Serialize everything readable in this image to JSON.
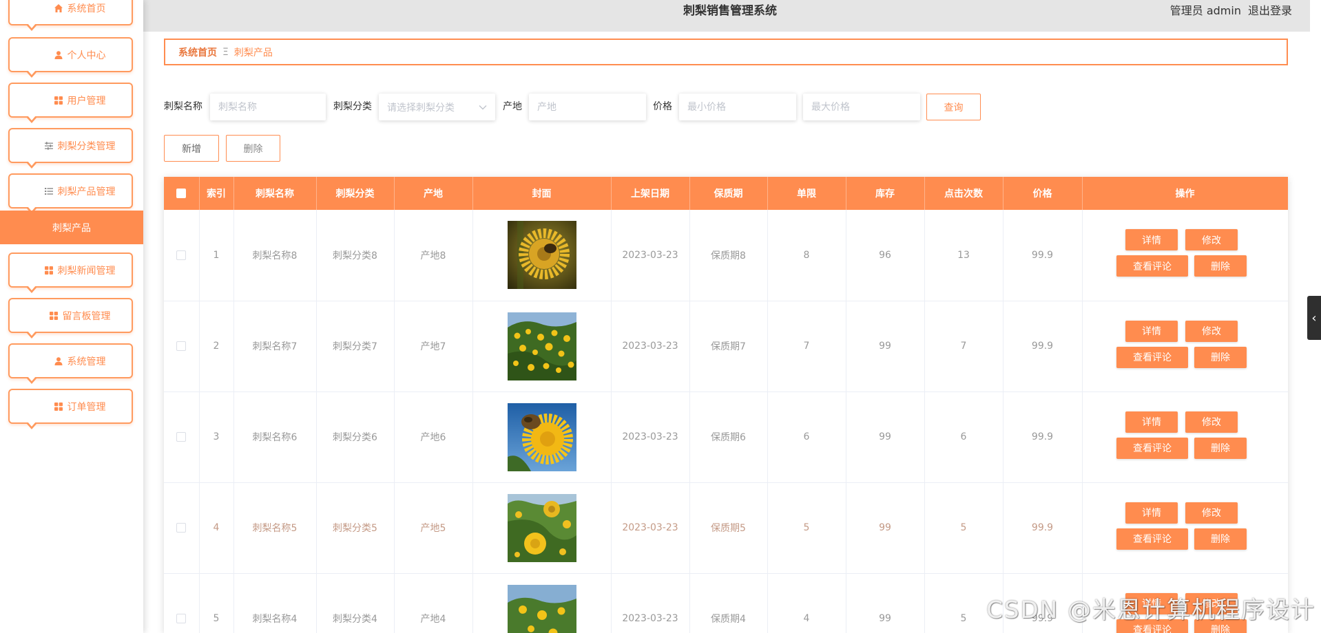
{
  "app": {
    "title": "刺梨销售管理系统",
    "user_label": "管理员 admin",
    "logout_label": "退出登录"
  },
  "sidebar": {
    "items": [
      {
        "label": "系统首页",
        "icon": "home-icon"
      },
      {
        "label": "个人中心",
        "icon": "user-icon"
      },
      {
        "label": "用户管理",
        "icon": "grid-icon"
      },
      {
        "label": "刺梨分类管理",
        "icon": "sliders-icon"
      },
      {
        "label": "刺梨产品管理",
        "icon": "list-icon"
      },
      {
        "label": "刺梨新闻管理",
        "icon": "grid-icon"
      },
      {
        "label": "留言板管理",
        "icon": "grid-icon"
      },
      {
        "label": "系统管理",
        "icon": "user-icon"
      },
      {
        "label": "订单管理",
        "icon": "grid-icon"
      }
    ],
    "active_subitem": "刺梨产品"
  },
  "breadcrumb": {
    "home": "系统首页",
    "separator": "Ξ",
    "current": "刺梨产品"
  },
  "search": {
    "name_label": "刺梨名称",
    "name_placeholder": "刺梨名称",
    "category_label": "刺梨分类",
    "category_placeholder": "请选择刺梨分类",
    "origin_label": "产地",
    "origin_placeholder": "产地",
    "price_label": "价格",
    "min_price_placeholder": "最小价格",
    "max_price_placeholder": "最大价格",
    "query_label": "查询"
  },
  "toolbar": {
    "add_label": "新增",
    "delete_label": "删除"
  },
  "table": {
    "columns": [
      "索引",
      "刺梨名称",
      "刺梨分类",
      "产地",
      "封面",
      "上架日期",
      "保质期",
      "单限",
      "库存",
      "点击次数",
      "价格",
      "操作"
    ],
    "row_actions": {
      "detail": "详情",
      "edit": "修改",
      "comments": "查看评论",
      "delete": "删除"
    },
    "rows": [
      {
        "index": "1",
        "name": "刺梨名称8",
        "category": "刺梨分类8",
        "origin": "产地8",
        "date": "2023-03-23",
        "shelf_life": "保质期8",
        "limit": "8",
        "stock": "96",
        "clicks": "13",
        "price": "99.9"
      },
      {
        "index": "2",
        "name": "刺梨名称7",
        "category": "刺梨分类7",
        "origin": "产地7",
        "date": "2023-03-23",
        "shelf_life": "保质期7",
        "limit": "7",
        "stock": "99",
        "clicks": "7",
        "price": "99.9"
      },
      {
        "index": "3",
        "name": "刺梨名称6",
        "category": "刺梨分类6",
        "origin": "产地6",
        "date": "2023-03-23",
        "shelf_life": "保质期6",
        "limit": "6",
        "stock": "99",
        "clicks": "6",
        "price": "99.9"
      },
      {
        "index": "4",
        "name": "刺梨名称5",
        "category": "刺梨分类5",
        "origin": "产地5",
        "date": "2023-03-23",
        "shelf_life": "保质期5",
        "limit": "5",
        "stock": "99",
        "clicks": "5",
        "price": "99.9"
      },
      {
        "index": "5",
        "name": "刺梨名称4",
        "category": "刺梨分类4",
        "origin": "产地4",
        "date": "2023-03-23",
        "shelf_life": "保质期4",
        "limit": "4",
        "stock": "99",
        "clicks": "5",
        "price": "99.9"
      }
    ]
  },
  "colors": {
    "accent": "#ff8c4f",
    "topbar_bg": "#e5e5e5",
    "cell_text": "#999999",
    "collapse_tab": "#2f2f2f"
  },
  "icons": {
    "collapse_tab": "chevron-left-icon",
    "select_arrow": "chevron-down-icon",
    "breadcrumb_separator": "menu-icon"
  },
  "watermark": "CSDN @米恩计算机程序设计"
}
